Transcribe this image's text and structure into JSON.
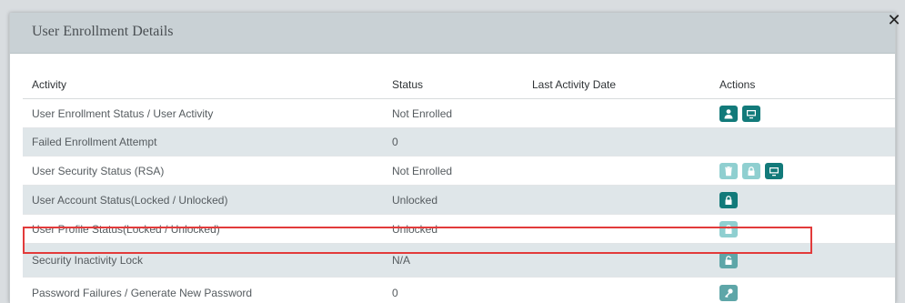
{
  "modal": {
    "title": "User Enrollment Details",
    "close_glyph": "✕"
  },
  "table": {
    "headers": {
      "activity": "Activity",
      "status": "Status",
      "last_activity": "Last Activity Date",
      "actions": "Actions"
    },
    "rows": [
      {
        "activity": "User Enrollment Status / User Activity",
        "status": "Not Enrolled",
        "last_activity": "",
        "actions": [
          "user-icon",
          "monitor-icon"
        ]
      },
      {
        "activity": "Failed Enrollment Attempt",
        "status": "0",
        "last_activity": "",
        "actions": []
      },
      {
        "activity": "User Security Status (RSA)",
        "status": "Not Enrolled",
        "last_activity": "",
        "actions": [
          "trash-icon",
          "lock-icon",
          "monitor-icon"
        ]
      },
      {
        "activity": "User Account Status(Locked / Unlocked)",
        "status": "Unlocked",
        "last_activity": "",
        "actions": [
          "lock-icon"
        ]
      },
      {
        "activity": "User Profile Status(Locked / Unlocked)",
        "status": "Unlocked",
        "last_activity": "",
        "actions": [
          "lock-icon"
        ]
      },
      {
        "activity": "Security Inactivity Lock",
        "status": "N/A",
        "last_activity": "",
        "actions": [
          "unlock-icon"
        ]
      },
      {
        "activity": "Password Failures / Generate New Password",
        "status": "0",
        "last_activity": "",
        "actions": [
          "key-icon"
        ]
      }
    ]
  },
  "colors": {
    "accent": "#127a7a",
    "accent_muted": "#8fcfd0",
    "highlight": "#e23b3b",
    "row_alt": "#dfe6e9",
    "header_bg": "#c9d1d5"
  }
}
